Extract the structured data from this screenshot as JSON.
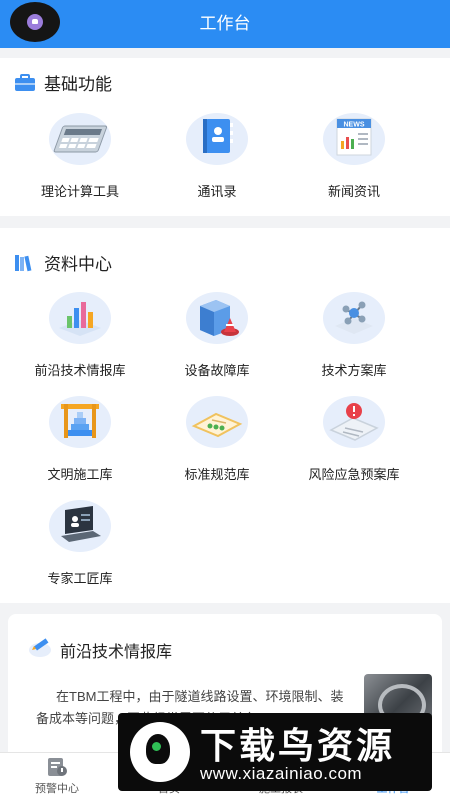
{
  "header": {
    "title": "工作台"
  },
  "basic": {
    "title": "基础功能",
    "items": [
      {
        "label": "理论计算工具",
        "icon": "calculator-icon"
      },
      {
        "label": "通讯录",
        "icon": "contacts-book-icon"
      },
      {
        "label": "新闻资讯",
        "icon": "newspaper-icon",
        "badge": "NEWS"
      }
    ]
  },
  "resources": {
    "title": "资料中心",
    "items": [
      {
        "label": "前沿技术情报库",
        "icon": "bar-chart-icon"
      },
      {
        "label": "设备故障库",
        "icon": "server-alert-icon"
      },
      {
        "label": "技术方案库",
        "icon": "molecule-icon"
      },
      {
        "label": "文明施工库",
        "icon": "construction-stairs-icon"
      },
      {
        "label": "标准规范库",
        "icon": "document-board-icon"
      },
      {
        "label": "风险应急预案库",
        "icon": "warning-document-icon"
      },
      {
        "label": "专家工匠库",
        "icon": "laptop-expert-icon"
      }
    ]
  },
  "news": {
    "title": "前沿技术情报库",
    "text": "在TBM工程中，由于隧道线路设置、环境限制、装备成本等问题，因此经常需要使用单台"
  },
  "tabbar": {
    "items": [
      {
        "label": "预警中心"
      },
      {
        "label": "首页"
      },
      {
        "label": "施工报表"
      },
      {
        "label": "工作台"
      }
    ]
  },
  "watermark": {
    "title": "下载鸟资源",
    "url": "www.xiazainiao.com"
  },
  "colors": {
    "primary": "#2b8cf3",
    "background": "#f2f3f5"
  }
}
